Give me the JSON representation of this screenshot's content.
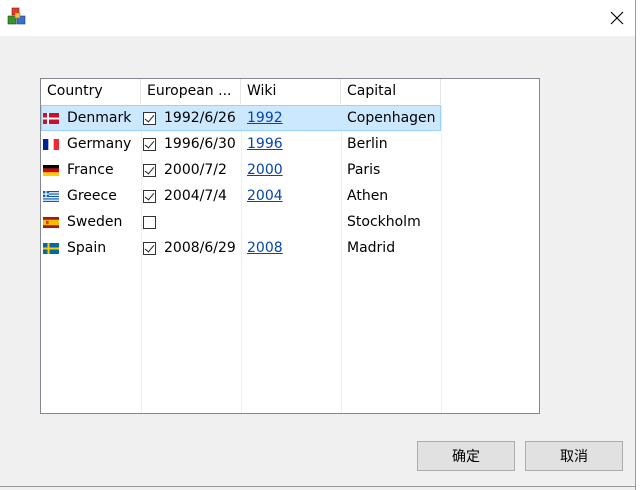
{
  "dialog": {
    "ok_label": "确定",
    "cancel_label": "取消",
    "close_icon": "close-icon",
    "app_icon": "app-icon"
  },
  "table": {
    "columns": [
      "Country",
      "European ...",
      "Wiki",
      "Capital"
    ],
    "rows": [
      {
        "flag": "denmark",
        "country": "Denmark",
        "joined_checked": true,
        "date": "1992/6/26",
        "wiki": "1992",
        "capital": "Copenhagen",
        "selected": true
      },
      {
        "flag": "germany",
        "country": "Germany",
        "joined_checked": true,
        "date": "1996/6/30",
        "wiki": "1996",
        "capital": "Berlin"
      },
      {
        "flag": "france",
        "country": "France",
        "joined_checked": true,
        "date": "2000/7/2",
        "wiki": "2000",
        "capital": "Paris"
      },
      {
        "flag": "greece",
        "country": "Greece",
        "joined_checked": true,
        "date": "2004/7/4",
        "wiki": "2004",
        "capital": "Athen"
      },
      {
        "flag": "sweden",
        "country": "Sweden",
        "joined_checked": false,
        "date": "",
        "wiki": "",
        "capital": "Stockholm"
      },
      {
        "flag": "spain",
        "country": "Spain",
        "joined_checked": true,
        "date": "2008/6/29",
        "wiki": "2008",
        "capital": "Madrid"
      }
    ]
  },
  "colors": {
    "selection": "#cce8ff",
    "link": "#0645ad",
    "button": "#e1e1e1"
  }
}
